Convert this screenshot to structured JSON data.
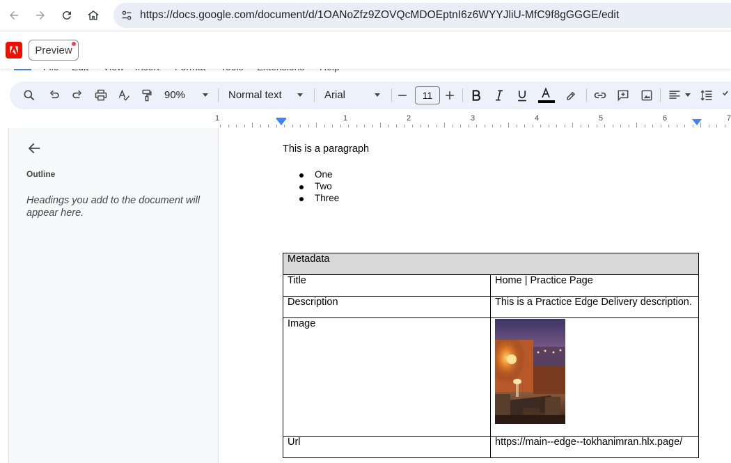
{
  "browser": {
    "url": "https://docs.google.com/document/d/1OANoZfz9ZOVQcMDOEptnI6z6WYYJliU-MfC9f8gGGGE/edit",
    "icons": [
      "back-arrow-icon",
      "forward-arrow-icon",
      "reload-icon",
      "home-icon",
      "site-settings-icon"
    ]
  },
  "extension": {
    "logo": "adobe-logo-icon",
    "brand_color": "#eb1000",
    "preview_label": "Preview"
  },
  "menu": {
    "items": [
      "File",
      "Edit",
      "View",
      "Insert",
      "Format",
      "Tools",
      "Extensions",
      "Help"
    ]
  },
  "toolbar": {
    "zoom": "90%",
    "style": "Normal text",
    "font": "Arial",
    "font_size": "11",
    "icons": [
      "search-icon",
      "undo-icon",
      "redo-icon",
      "print-icon",
      "spellcheck-icon",
      "paint-format-icon",
      "decrease-size-icon",
      "increase-size-icon",
      "bold-icon",
      "italic-icon",
      "underline-icon",
      "text-color-icon",
      "highlight-icon",
      "link-icon",
      "comment-icon",
      "image-icon",
      "align-icon",
      "line-spacing-icon",
      "checklist-icon"
    ]
  },
  "ruler": {
    "labels": [
      "1",
      "1",
      "2",
      "3",
      "4",
      "5",
      "6",
      "7"
    ]
  },
  "outline": {
    "title": "Outline",
    "hint": "Headings you add to the document will appear here."
  },
  "document": {
    "paragraph": "This is a paragraph",
    "list": [
      "One",
      "Two",
      "Three"
    ],
    "table": {
      "header": "Metadata",
      "rows": [
        {
          "key": "Title",
          "value": "Home | Practice Page"
        },
        {
          "key": "Description",
          "value": "This is a Practice Edge Delivery description."
        },
        {
          "key": "Image",
          "value": ""
        },
        {
          "key": "Url",
          "value": "https://main--edge--tokhanimran.hlx.page/"
        }
      ]
    }
  },
  "colors": {
    "toolbar_bg": "#edf2fa",
    "url_pill_bg": "#e9eef6",
    "outline_bg": "#f8f9fa",
    "table_header_bg": "#d9d9d9",
    "accent": "#4285f4"
  }
}
